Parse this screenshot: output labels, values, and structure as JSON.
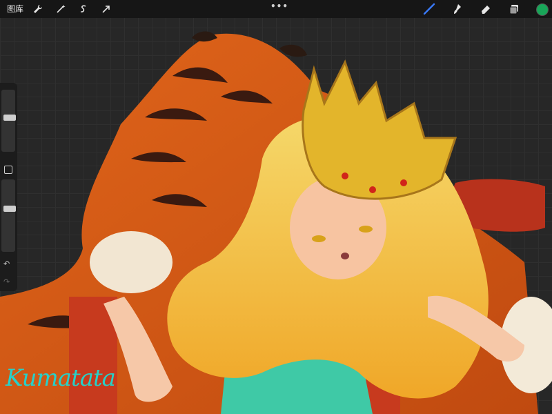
{
  "topbar": {
    "gallery_label": "图库",
    "tools_left": [
      "wrench-icon",
      "magic-wand-icon",
      "selection-icon",
      "transform-arrow-icon"
    ],
    "more_label": "•••",
    "tools_right": [
      "brush-icon",
      "smudge-icon",
      "eraser-icon",
      "layers-icon"
    ],
    "current_color": "#18a558",
    "active_tool_color": "#3a7bff"
  },
  "sidebar": {
    "brush_size": 0.55,
    "brush_opacity": 0.6,
    "undo_label": "↶",
    "redo_label": "↷"
  },
  "artwork": {
    "signature": "Kumatata"
  }
}
